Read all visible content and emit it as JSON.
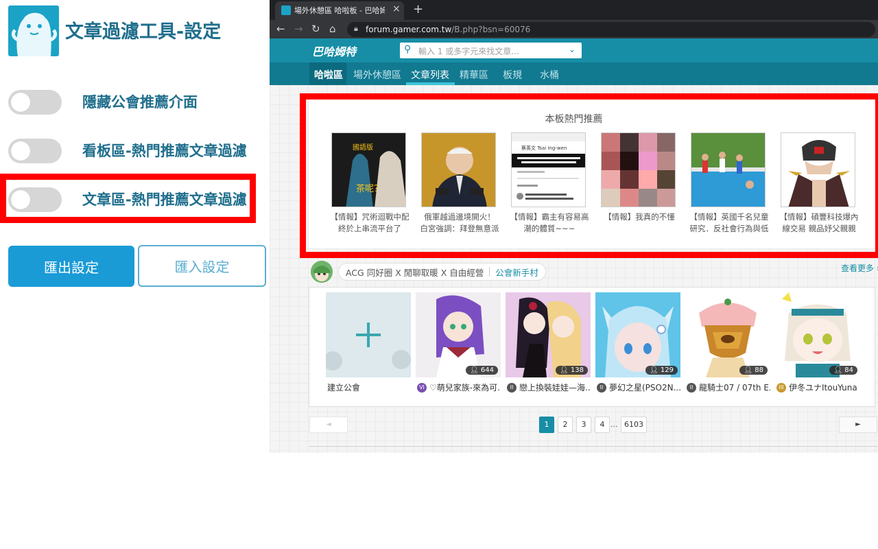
{
  "panel": {
    "title": "文章過濾工具-設定",
    "toggles": [
      {
        "label": "隱藏公會推薦介面",
        "state": "off"
      },
      {
        "label": "看板區-熱門推薦文章過濾",
        "state": "off"
      },
      {
        "label": "文章區-熱門推薦文章過濾",
        "state": "off"
      }
    ],
    "export_label": "匯出設定",
    "import_label": "匯入設定"
  },
  "browser": {
    "tab_title": "場外休憩區 哈啦板 - 巴哈姆特",
    "tab_close": "×",
    "new_tab": "+",
    "url_host": "forum.gamer.com.tw",
    "url_path": "/B.php?bsn=60076"
  },
  "site": {
    "logo_text": "巴哈姆特",
    "search_placeholder": "輸入 1 或多字元來找文章...",
    "nav": [
      "哈啦區",
      "場外休憩區",
      "文章列表",
      "精華區",
      "板規",
      "水桶"
    ],
    "active_nav": "文章列表"
  },
  "hot": {
    "title": "本板熱門推薦",
    "items": [
      {
        "caption": "【情報】咒術迴戰中配終於上串流平台了",
        "thumb_text": "國語版 / 茶呢？"
      },
      {
        "caption": "俄軍越過邊境開火！　白宮強調：拜登無意派",
        "thumb_text": ""
      },
      {
        "caption": "【情報】霸主有容易高潮的體質~~~",
        "thumb_text": "蔡英文 Tsai Ing-wen"
      },
      {
        "caption": "【情報】我真的不懂",
        "thumb_text": ""
      },
      {
        "caption": "【情報】英國千名兒童研究．反社會行為與低",
        "thumb_text": ""
      },
      {
        "caption": "【情報】碩豐科技爆內線交易 親品妤父親親",
        "thumb_text": ""
      }
    ]
  },
  "guild": {
    "tags": "ACG 同好圈 X 閒聊取暖 X 自由經營",
    "link": "公會新手村",
    "view_more": "查看更多 ›",
    "create_label": "建立公會",
    "items": [
      {
        "name": "♡萌兒家族-來為可...",
        "count": "644",
        "rank": "VI",
        "rank_color": "#7a4fb0"
      },
      {
        "name": "戀上換裝娃娃—海...",
        "count": "138",
        "rank": "II",
        "rank_color": "#666666"
      },
      {
        "name": "夢幻之星(PSO2N...",
        "count": "129",
        "rank": "II",
        "rank_color": "#666666"
      },
      {
        "name": "龍騎士07 / 07th E...",
        "count": "88",
        "rank": "II",
        "rank_color": "#666666"
      },
      {
        "name": "伊冬ユナItouYuna",
        "count": "84",
        "rank": "III",
        "rank_color": "#c99a2e"
      }
    ]
  },
  "pager": {
    "prev": "◄",
    "pages": [
      "1",
      "2",
      "3",
      "4"
    ],
    "ellipsis": "...",
    "last": "6103",
    "next": "►",
    "current": "1"
  },
  "colors": {
    "accent": "#178ea6",
    "highlight": "#ff0000",
    "export_button": "#1a9bd6",
    "panel_text": "#1f6e8c"
  }
}
